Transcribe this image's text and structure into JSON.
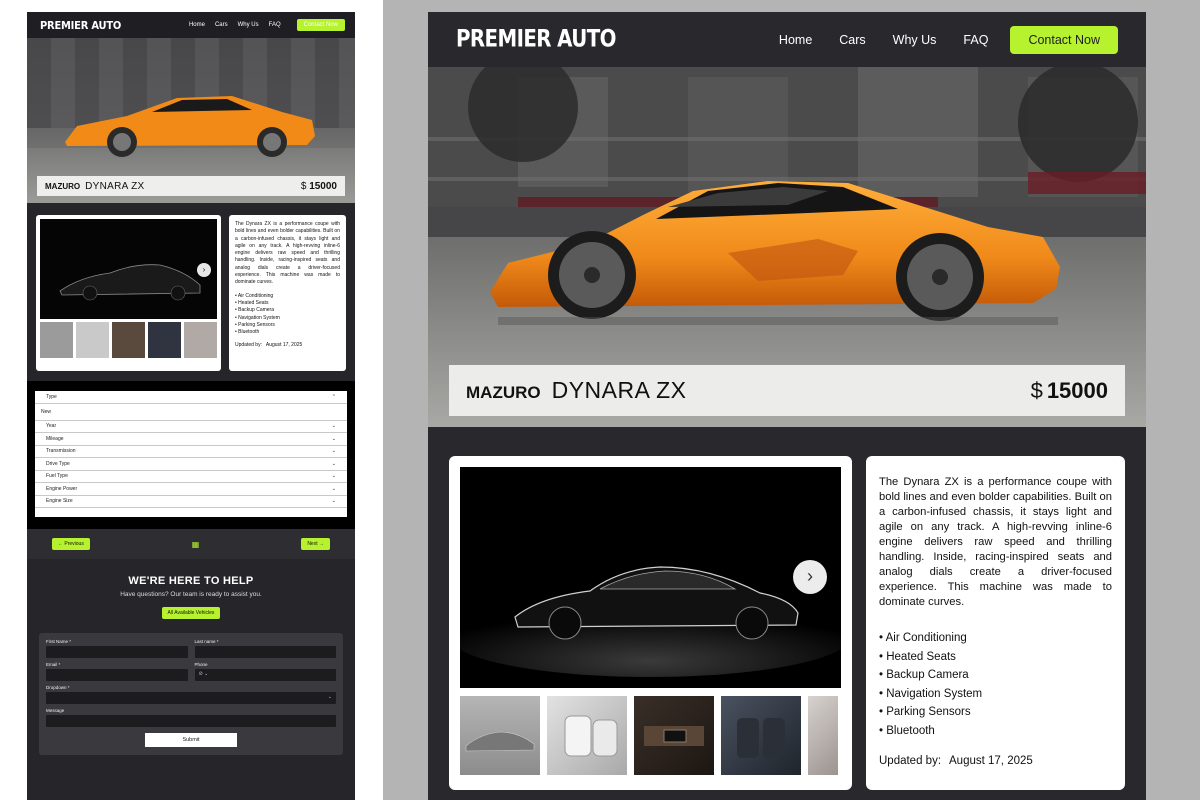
{
  "site": {
    "logo": "PREMIER AUTO",
    "nav": [
      "Home",
      "Cars",
      "Why Us",
      "FAQ"
    ],
    "cta": "Contact Now"
  },
  "vehicle": {
    "make": "MAZURO",
    "model": "DYNARA ZX",
    "currency": "$",
    "price": "15000",
    "description": "The Dynara ZX is a performance coupe with bold lines and even bolder capabilities. Built on a carbon-infused chassis, it stays light and agile on any track. A high-revving inline-6 engine delivers raw speed and thrilling handling. Inside, racing-inspired seats and analog dials create a driver-focused experience. This machine was made to dominate curves.",
    "features": [
      "Air Conditioning",
      "Heated Seats",
      "Backup Camera",
      "Navigation System",
      "Parking Sensors",
      "Bluetooth"
    ],
    "updated_label": "Updated by:",
    "updated_date": "August 17, 2025"
  },
  "filters": {
    "type_label": "Type",
    "type_value": "New",
    "rows": [
      "Year",
      "Mileage",
      "Transmission",
      "Drive Type",
      "Fuel Type",
      "Engine Power",
      "Engine Size"
    ]
  },
  "pager": {
    "prev": "← Previous",
    "next": "Next →"
  },
  "help": {
    "title": "WE'RE HERE TO HELP",
    "subtitle": "Have questions? Our team is ready to assist you.",
    "all_vehicles": "All Available Vehicles"
  },
  "form": {
    "first_name": "First Name *",
    "last_name": "Last name *",
    "email": "Email *",
    "phone": "Phone",
    "phone_value": "⊘ ⌄",
    "dropdown": "Dropdown *",
    "message": "Message",
    "submit": "Submit"
  },
  "colors": {
    "accent": "#b6f22e",
    "page_bg": "#29292d",
    "hero_car": "#f08a1a"
  }
}
